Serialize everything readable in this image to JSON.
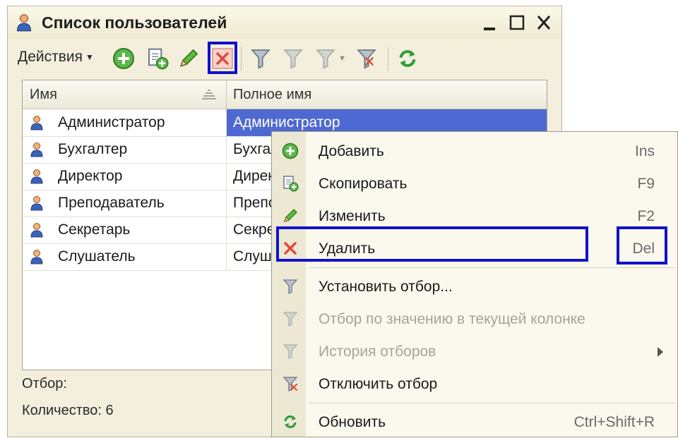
{
  "window": {
    "title": "Список пользователей"
  },
  "toolbar": {
    "actions_label": "Действия",
    "buttons": [
      "add-icon",
      "copy-icon",
      "edit-icon",
      "delete-icon",
      "set-filter-icon",
      "filter-by-value-icon",
      "filter-history-icon",
      "disable-filter-icon",
      "refresh-icon"
    ]
  },
  "table": {
    "columns": [
      "Имя",
      "Полное имя"
    ],
    "rows": [
      {
        "name": "Администратор",
        "full": "Администратор"
      },
      {
        "name": "Бухгалтер",
        "full": "Бухгалтер"
      },
      {
        "name": "Директор",
        "full": "Директор"
      },
      {
        "name": "Преподаватель",
        "full": "Преподаватель"
      },
      {
        "name": "Секретарь",
        "full": "Секретарь"
      },
      {
        "name": "Слушатель",
        "full": "Слушатель"
      }
    ]
  },
  "footer": {
    "filter_label": "Отбор:",
    "count_label": "Количество: 6"
  },
  "context_menu": {
    "items": [
      {
        "label": "Добавить",
        "shortcut": "Ins"
      },
      {
        "label": "Скопировать",
        "shortcut": "F9"
      },
      {
        "label": "Изменить",
        "shortcut": "F2"
      },
      {
        "label": "Удалить",
        "shortcut": "Del"
      },
      {
        "label": "Установить отбор...",
        "shortcut": ""
      },
      {
        "label": "Отбор по значению в текущей колонке",
        "shortcut": ""
      },
      {
        "label": "История отборов",
        "shortcut": ""
      },
      {
        "label": "Отключить отбор",
        "shortcut": ""
      },
      {
        "label": "Обновить",
        "shortcut": "Ctrl+Shift+R"
      }
    ]
  },
  "colors": {
    "highlight": "#1111cc",
    "selection": "#4f69d2",
    "window_bg": "#f3efdc"
  }
}
